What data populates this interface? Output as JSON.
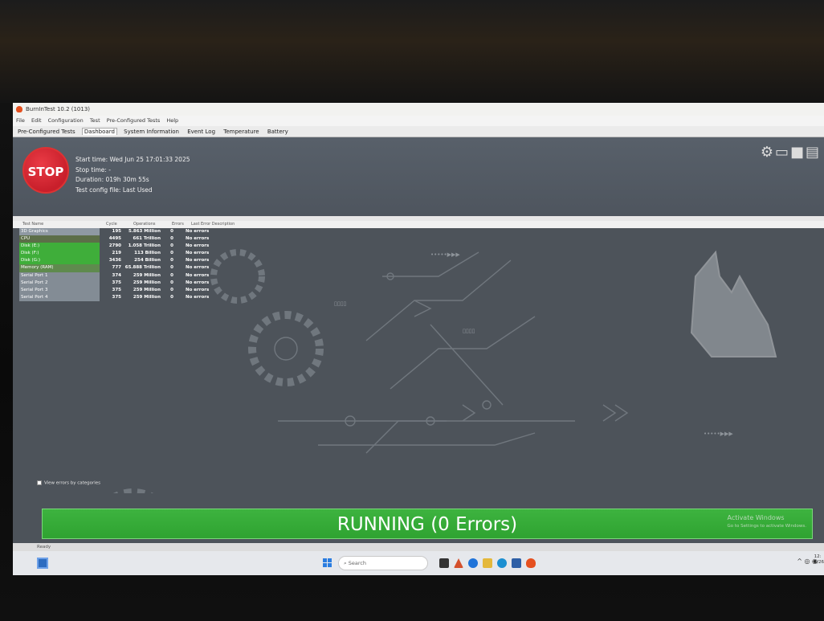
{
  "window": {
    "title": "BurnInTest 10.2 (1013)"
  },
  "menu": [
    "File",
    "Edit",
    "Configuration",
    "Test",
    "Pre-Configured Tests",
    "Help"
  ],
  "tabs": [
    {
      "label": "Pre-Configured Tests",
      "active": false
    },
    {
      "label": "Dashboard",
      "active": true
    },
    {
      "label": "System Information",
      "active": false
    },
    {
      "label": "Event Log",
      "active": false
    },
    {
      "label": "Temperature",
      "active": false
    },
    {
      "label": "Battery",
      "active": false
    }
  ],
  "header": {
    "stop_label": "STOP",
    "start_time": "Start time: Wed Jun 25 17:01:33 2025",
    "stop_time": "Stop time: -",
    "duration": "Duration: 019h 30m 55s",
    "config_file": "Test config file: Last Used"
  },
  "toolbar": {
    "icons": [
      "gear-icon",
      "monitor-icon",
      "save-icon",
      "printer-icon"
    ]
  },
  "table": {
    "headers": [
      "Test Name",
      "Cycle",
      "Operations",
      "Errors",
      "Last Error Description"
    ],
    "rows": [
      {
        "name": "3D Graphics",
        "cycle": "195",
        "operations": "5.863 Million",
        "errors": "0",
        "last_error": "No errors",
        "color": "#8f99a3"
      },
      {
        "name": "CPU",
        "cycle": "4495",
        "operations": "661 Trillion",
        "errors": "0",
        "last_error": "No errors",
        "color": "#5c6e48"
      },
      {
        "name": "Disk (E:)",
        "cycle": "2790",
        "operations": "1.058 Trillion",
        "errors": "0",
        "last_error": "No errors",
        "color": "#3fae3a"
      },
      {
        "name": "Disk (F:)",
        "cycle": "219",
        "operations": "113 Billion",
        "errors": "0",
        "last_error": "No errors",
        "color": "#3fae3a"
      },
      {
        "name": "Disk (G:)",
        "cycle": "3436",
        "operations": "254 Billion",
        "errors": "0",
        "last_error": "No errors",
        "color": "#3fae3a"
      },
      {
        "name": "Memory (RAM)",
        "cycle": "777",
        "operations": "65.888 Trillion",
        "errors": "0",
        "last_error": "No errors",
        "color": "#5f8a4e"
      },
      {
        "name": "Serial Port 1",
        "cycle": "374",
        "operations": "259 Million",
        "errors": "0",
        "last_error": "No errors",
        "color": "#838c95"
      },
      {
        "name": "Serial Port 2",
        "cycle": "375",
        "operations": "259 Million",
        "errors": "0",
        "last_error": "No errors",
        "color": "#838c95"
      },
      {
        "name": "Serial Port 3",
        "cycle": "375",
        "operations": "259 Million",
        "errors": "0",
        "last_error": "No errors",
        "color": "#838c95"
      },
      {
        "name": "Serial Port 4",
        "cycle": "375",
        "operations": "259 Million",
        "errors": "0",
        "last_error": "No errors",
        "color": "#838c95"
      }
    ]
  },
  "view_errors_label": "View errors by categories",
  "status": {
    "text": "RUNNING (0 Errors)",
    "color": "#3db33f"
  },
  "activate": {
    "title": "Activate Windows",
    "subtitle": "Go to Settings to activate Windows."
  },
  "statusbar": {
    "text": "Ready"
  },
  "taskbar": {
    "search_placeholder": "Search",
    "clock_time": "12:",
    "clock_date": "6/26"
  }
}
